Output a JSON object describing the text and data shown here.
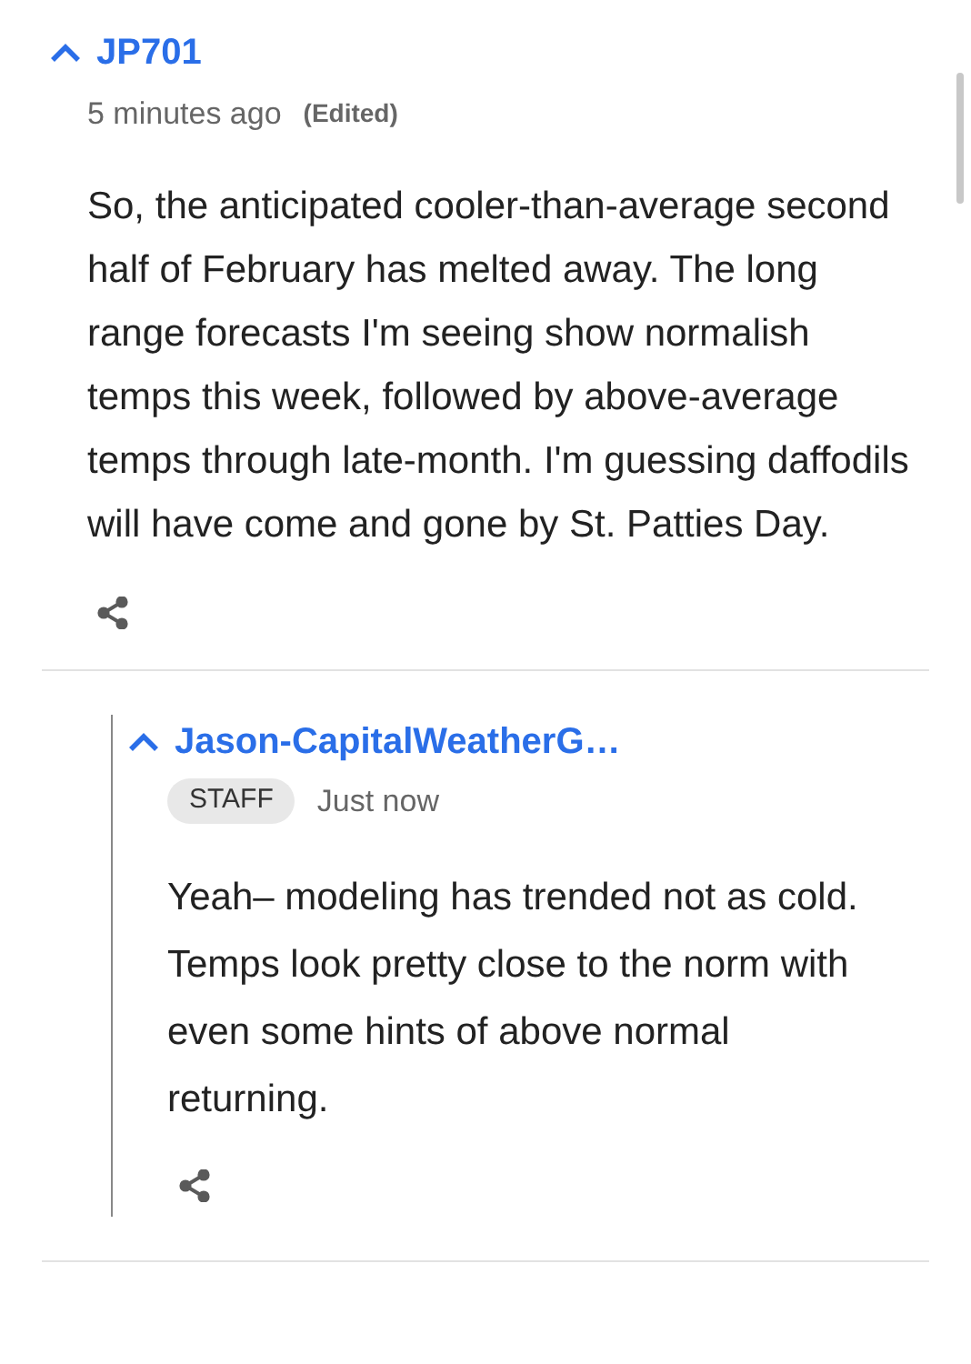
{
  "comments": [
    {
      "author": "JP701",
      "time": "5 minutes ago",
      "edited": "(Edited)",
      "body": "So, the anticipated cooler-than-average second half of February has melted away. The long range forecasts I'm seeing show normalish temps this week, followed by above-average temps through late-month. I'm guessing daffodils will have come and gone by St. Patties Day.",
      "replies": [
        {
          "author": "Jason-CapitalWeatherG…",
          "badge": "STAFF",
          "time": "Just now",
          "body": "Yeah– modeling has trended not as cold. Temps look pretty close to the norm with even some hints of above normal returning."
        }
      ]
    }
  ]
}
